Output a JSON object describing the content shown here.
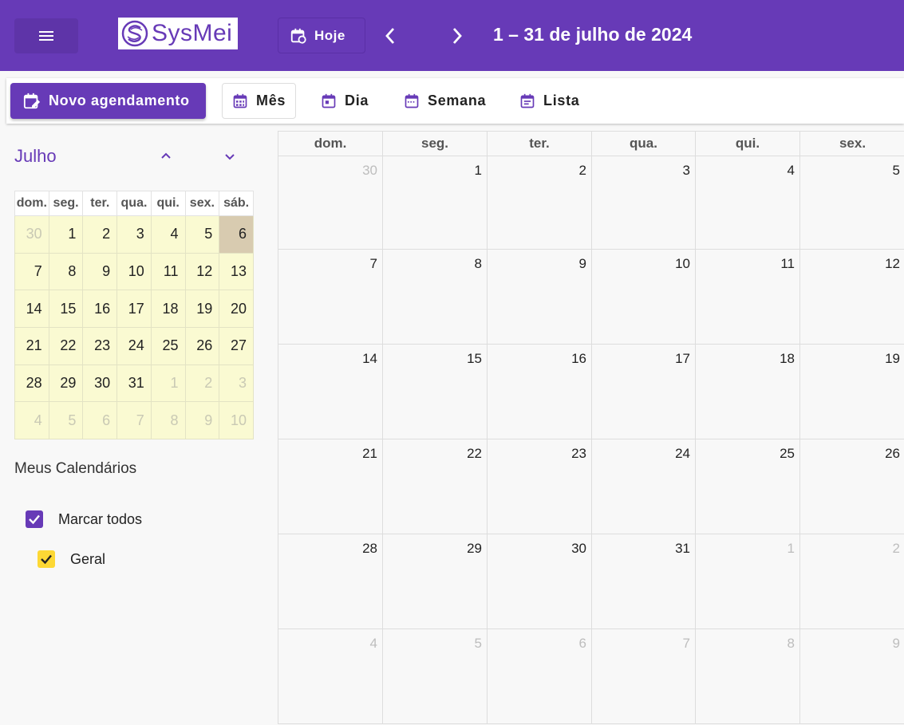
{
  "app": {
    "logo_text": "SysMei",
    "brand_color": "#673ab7"
  },
  "header": {
    "today_label": "Hoje",
    "range_title": "1 – 31 de julho de 2024"
  },
  "toolbar": {
    "new_label": "Novo agendamento",
    "views": [
      "Mês",
      "Dia",
      "Semana",
      "Lista"
    ],
    "active_view": "Mês"
  },
  "mini_calendar": {
    "month_title": "Julho",
    "weekdays": [
      "dom.",
      "seg.",
      "ter.",
      "qua.",
      "qui.",
      "sex.",
      "sáb."
    ],
    "weeks": [
      [
        "30",
        "1",
        "2",
        "3",
        "4",
        "5",
        "6"
      ],
      [
        "7",
        "8",
        "9",
        "10",
        "11",
        "12",
        "13"
      ],
      [
        "14",
        "15",
        "16",
        "17",
        "18",
        "19",
        "20"
      ],
      [
        "21",
        "22",
        "23",
        "24",
        "25",
        "26",
        "27"
      ],
      [
        "28",
        "29",
        "30",
        "31",
        "1",
        "2",
        "3"
      ],
      [
        "4",
        "5",
        "6",
        "7",
        "8",
        "9",
        "10"
      ]
    ],
    "selected_day": "6"
  },
  "calendars": {
    "title": "Meus Calendários",
    "select_all_label": "Marcar todos",
    "items": [
      {
        "label": "Geral",
        "color": "#fdd835",
        "checked": true
      }
    ]
  },
  "month_view": {
    "weekdays": [
      "dom.",
      "seg.",
      "ter.",
      "qua.",
      "qui.",
      "sex."
    ],
    "weeks": [
      [
        "30",
        "1",
        "2",
        "3",
        "4",
        "5"
      ],
      [
        "7",
        "8",
        "9",
        "10",
        "11",
        "12"
      ],
      [
        "14",
        "15",
        "16",
        "17",
        "18",
        "19"
      ],
      [
        "21",
        "22",
        "23",
        "24",
        "25",
        "26"
      ],
      [
        "28",
        "29",
        "30",
        "31",
        "1",
        "2"
      ],
      [
        "4",
        "5",
        "6",
        "7",
        "8",
        "9"
      ]
    ]
  }
}
